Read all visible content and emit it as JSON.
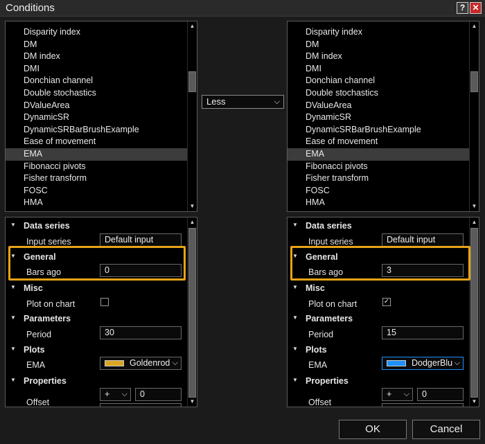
{
  "window": {
    "title": "Conditions",
    "help_label": "?",
    "close_label": "✕"
  },
  "indicators": [
    "Disparity index",
    "DM",
    "DM index",
    "DMI",
    "Donchian channel",
    "Double stochastics",
    "DValueArea",
    "DynamicSR",
    "DynamicSRBarBrushExample",
    "Ease of movement",
    "EMA",
    "Fibonacci pivots",
    "Fisher transform",
    "FOSC",
    "HMA"
  ],
  "selected_indicator": "EMA",
  "comparison": {
    "value": "Less"
  },
  "left": {
    "data_series_label": "Data series",
    "input_series_label": "Input series",
    "input_series_value": "Default input",
    "general_label": "General",
    "bars_ago_label": "Bars ago",
    "bars_ago_value": "0",
    "misc_label": "Misc",
    "plot_on_chart_label": "Plot on chart",
    "plot_on_chart_checked": false,
    "parameters_label": "Parameters",
    "period_label": "Period",
    "period_value": "30",
    "plots_label": "Plots",
    "ema_label": "EMA",
    "ema_brush": "Goldenrod",
    "ema_color": "#daa520",
    "properties_label": "Properties",
    "offset_label": "Offset",
    "offset_op": "+",
    "offset_value": "0"
  },
  "right": {
    "data_series_label": "Data series",
    "input_series_label": "Input series",
    "input_series_value": "Default input",
    "general_label": "General",
    "bars_ago_label": "Bars ago",
    "bars_ago_value": "3",
    "misc_label": "Misc",
    "plot_on_chart_label": "Plot on chart",
    "plot_on_chart_checked": true,
    "parameters_label": "Parameters",
    "period_label": "Period",
    "period_value": "15",
    "plots_label": "Plots",
    "ema_label": "EMA",
    "ema_brush": "DodgerBlu",
    "ema_color": "#1e90ff",
    "properties_label": "Properties",
    "offset_label": "Offset",
    "offset_op": "+",
    "offset_value": "0"
  },
  "buttons": {
    "ok": "OK",
    "cancel": "Cancel"
  },
  "colors": {
    "highlight": "#e8a317",
    "background": "#1b1b1b"
  }
}
